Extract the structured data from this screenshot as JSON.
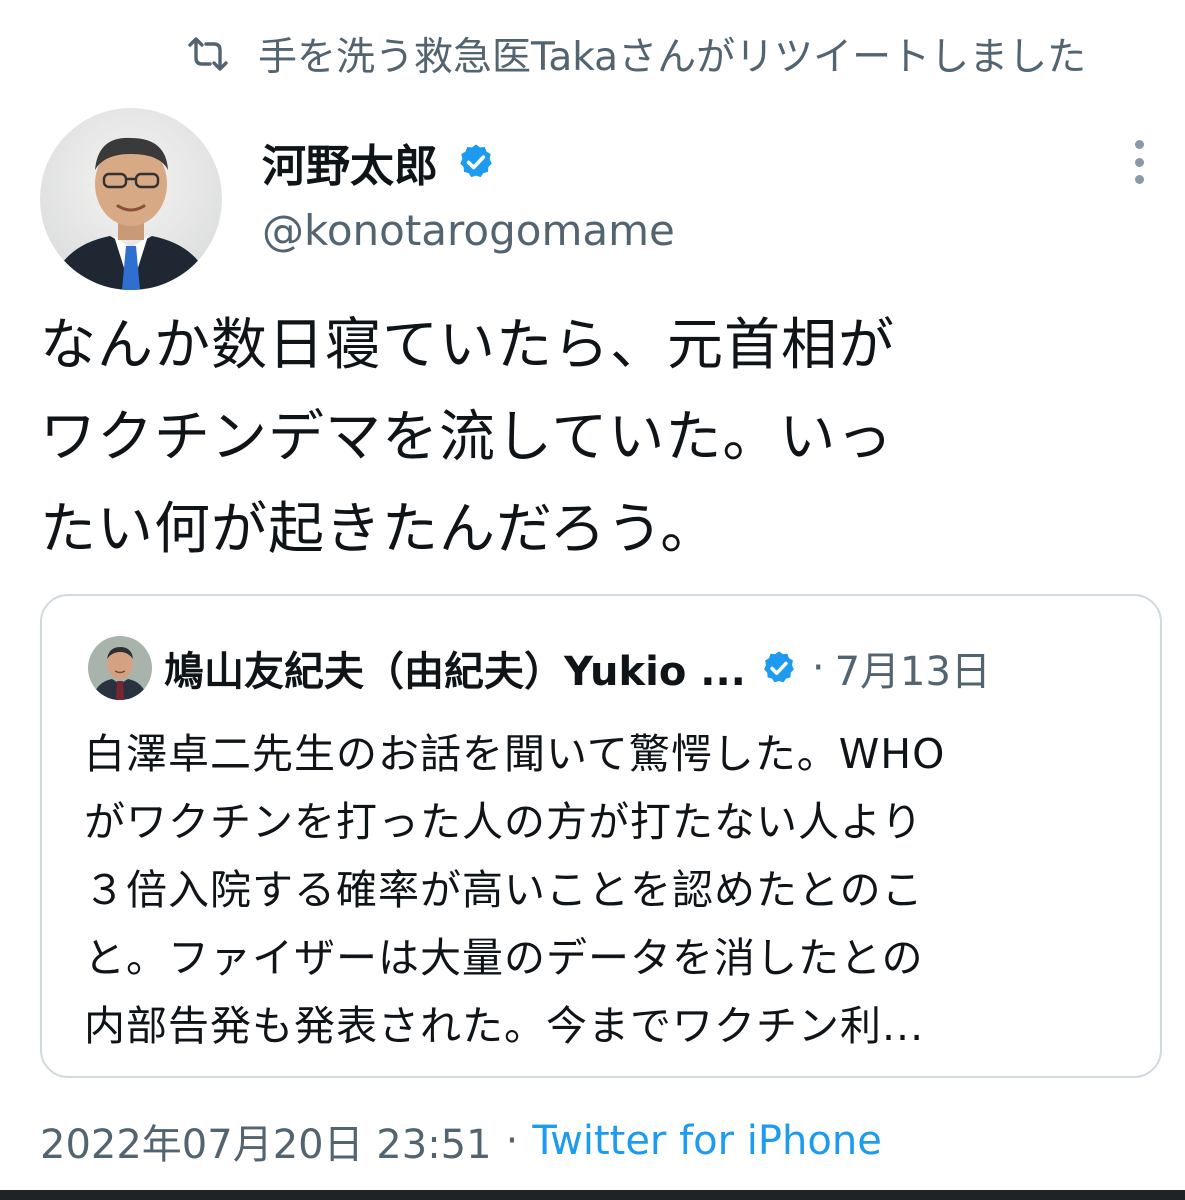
{
  "retweet": {
    "icon": "retweet-icon",
    "text": "手を洗う救急医Takaさんがリツイートしました"
  },
  "tweet": {
    "author_name": "河野太郎",
    "handle": "@konotarogomame",
    "verified_icon": "verified-badge-icon",
    "more_icon": "more-vertical-icon",
    "text": "なんか数日寝ていたら、元首相が\nワクチンデマを流していた。いっ\nたい何が起きたんだろう。",
    "timestamp": "2022年07月20日 23:51",
    "separator": "·",
    "source": "Twitter for iPhone"
  },
  "quoted_tweet": {
    "author_name": "鳩山友紀夫（由紀夫）Yukio ...",
    "separator": "·",
    "date": "7月13日",
    "text": "白澤卓二先生のお話を聞いて驚愕した。WHO\nがワクチンを打った人の方が打たない人より\n３倍入院する確率が高いことを認めたとのこ\nと。ファイザーは大量のデータを消したとの\n内部告発も発表された。今までワクチン利..."
  },
  "colors": {
    "text_primary": "#0f1419",
    "text_secondary": "#536471",
    "link_blue": "#1d9bf0",
    "border": "#cfd9de"
  }
}
